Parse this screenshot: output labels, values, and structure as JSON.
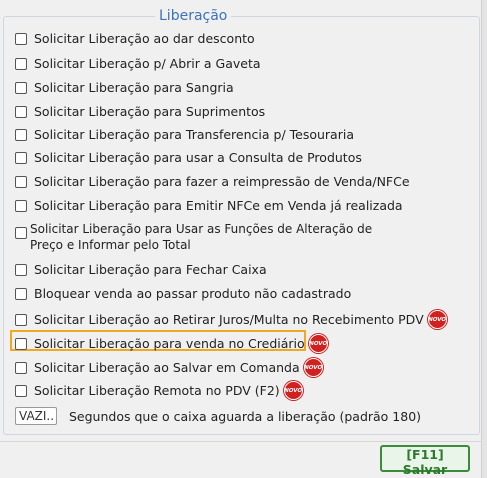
{
  "group": {
    "title": "Liberação"
  },
  "options": [
    {
      "label": "Solicitar Liberação ao dar desconto",
      "checked": false,
      "is_new": false
    },
    {
      "label": "Solicitar Liberação p/ Abrir a Gaveta",
      "checked": false,
      "is_new": false
    },
    {
      "label": "Solicitar Liberação para Sangria",
      "checked": false,
      "is_new": false
    },
    {
      "label": "Solicitar Liberação para Suprimentos",
      "checked": false,
      "is_new": false
    },
    {
      "label": "Solicitar Liberação para Transferencia p/ Tesouraria",
      "checked": false,
      "is_new": false
    },
    {
      "label": "Solicitar Liberação para usar a Consulta de Produtos",
      "checked": false,
      "is_new": false
    },
    {
      "label": "Solicitar Liberação para fazer a reimpressão de Venda/NFCe",
      "checked": false,
      "is_new": false
    },
    {
      "label": "Solicitar Liberação para Emitir NFCe em Venda já realizada",
      "checked": false,
      "is_new": false
    },
    {
      "label": "Solicitar Liberação para Usar as Funções de Alteração de Preço e Informar pelo Total",
      "checked": false,
      "is_new": false
    },
    {
      "label": "Solicitar Liberação para Fechar Caixa",
      "checked": false,
      "is_new": false
    },
    {
      "label": "Bloquear venda ao passar produto não cadastrado",
      "checked": false,
      "is_new": false
    },
    {
      "label": "Solicitar Liberação ao Retirar Juros/Multa no Recebimento PDV",
      "checked": false,
      "is_new": true
    },
    {
      "label": "Solicitar Liberação para venda no Crediário",
      "checked": false,
      "is_new": true,
      "highlighted": true
    },
    {
      "label": "Solicitar Liberação ao Salvar em Comanda",
      "checked": false,
      "is_new": true
    },
    {
      "label": "Solicitar Liberação Remota no PDV (F2)",
      "checked": false,
      "is_new": true
    }
  ],
  "badge_text": "NOVO",
  "timeout": {
    "value": "VAZI...",
    "label": "Segundos que o caixa aguarda a liberação (padrão 180)"
  },
  "actions": {
    "save_label": "[F11] Salvar"
  },
  "colors": {
    "legend": "#3b74b8",
    "highlight": "#f0a820",
    "badge": "#d02020",
    "save": "#2b7a2b"
  }
}
